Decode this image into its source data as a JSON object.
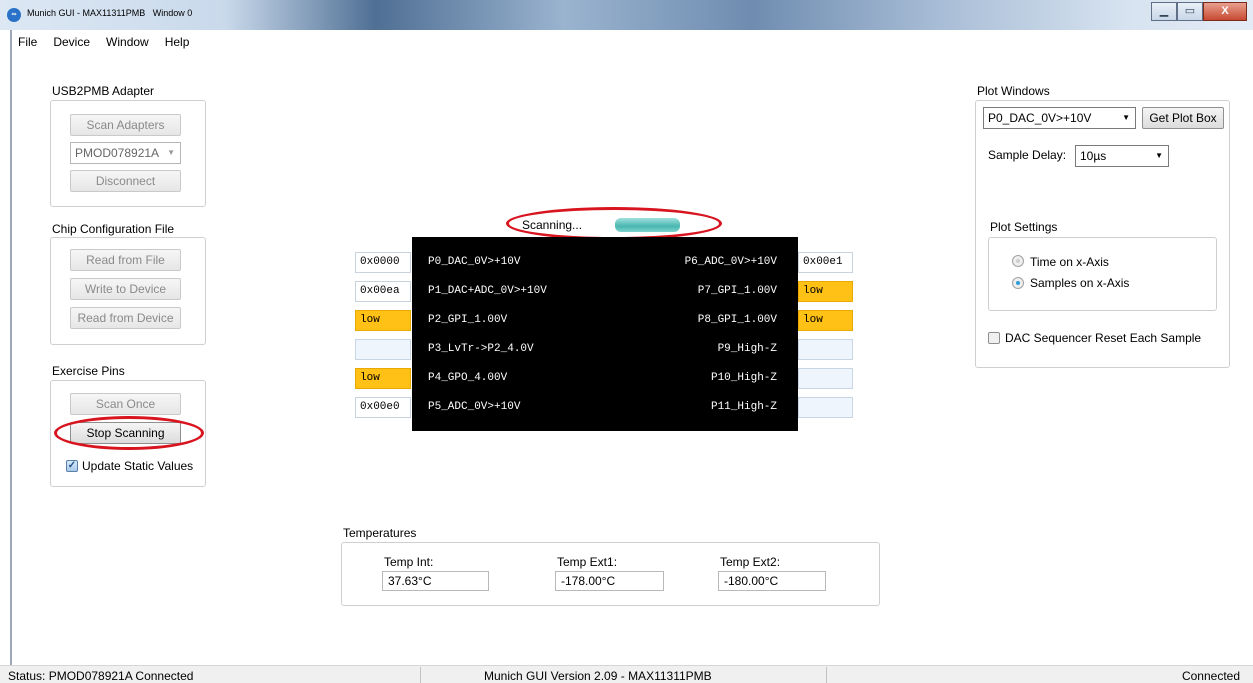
{
  "window": {
    "title": "Munich GUI - MAX11311PMB",
    "subtitle": "Window 0",
    "min_label": "▁",
    "max_label": "▭",
    "close_label": "X"
  },
  "menu": [
    "File",
    "Device",
    "Window",
    "Help"
  ],
  "usb_adapter": {
    "title": "USB2PMB Adapter",
    "scan_label": "Scan Adapters",
    "selected_adapter": "PMOD078921A",
    "disconnect_label": "Disconnect"
  },
  "chip_config": {
    "title": "Chip Configuration File",
    "read_file_label": "Read from File",
    "write_device_label": "Write to Device",
    "read_device_label": "Read from Device"
  },
  "exercise_pins": {
    "title": "Exercise Pins",
    "scan_once_label": "Scan Once",
    "stop_label": "Stop Scanning",
    "update_static_label": "Update Static Values",
    "update_static_checked": true
  },
  "scanning": {
    "label": "Scanning...",
    "progress": 1.0
  },
  "pins_left": [
    {
      "value": "0x0000",
      "style": "white",
      "name": "P0_DAC_0V>+10V"
    },
    {
      "value": "0x00ea",
      "style": "white",
      "name": "P1_DAC+ADC_0V>+10V"
    },
    {
      "value": "low",
      "style": "low",
      "name": "P2_GPI_1.00V"
    },
    {
      "value": "",
      "style": "empty",
      "name": "P3_LvTr->P2_4.0V"
    },
    {
      "value": "low",
      "style": "low",
      "name": "P4_GPO_4.00V"
    },
    {
      "value": "0x00e0",
      "style": "white",
      "name": "P5_ADC_0V>+10V"
    }
  ],
  "pins_right": [
    {
      "value": "0x00e1",
      "style": "white",
      "name": "P6_ADC_0V>+10V"
    },
    {
      "value": "low",
      "style": "low",
      "name": "P7_GPI_1.00V"
    },
    {
      "value": "low",
      "style": "low",
      "name": "P8_GPI_1.00V"
    },
    {
      "value": "",
      "style": "empty",
      "name": "P9_High-Z"
    },
    {
      "value": "",
      "style": "empty",
      "name": "P10_High-Z"
    },
    {
      "value": "",
      "style": "empty",
      "name": "P11_High-Z"
    }
  ],
  "temperatures": {
    "title": "Temperatures",
    "int_label": "Temp Int:",
    "int_value": "37.63°C",
    "ext1_label": "Temp Ext1:",
    "ext1_value": "-178.00°C",
    "ext2_label": "Temp Ext2:",
    "ext2_value": "-180.00°C"
  },
  "plot_windows": {
    "title": "Plot Windows",
    "selected_plot": "P0_DAC_0V>+10V",
    "get_plot_label": "Get Plot Box",
    "sample_delay_label": "Sample Delay:",
    "sample_delay_value": "10µs",
    "settings_title": "Plot Settings",
    "time_axis_label": "Time on x-Axis",
    "samples_axis_label": "Samples on x-Axis",
    "dac_reset_label": "DAC Sequencer Reset Each Sample",
    "dac_reset_checked": false
  },
  "status": {
    "left": "Status: PMOD078921A Connected",
    "center": "Munich GUI Version 2.09 - MAX11311PMB",
    "right": "Connected"
  },
  "colors": {
    "low_highlight": "#ffc116",
    "highlight_ellipse": "#d8141f",
    "pin_panel": "#000000",
    "progress": "#49b7b0"
  }
}
